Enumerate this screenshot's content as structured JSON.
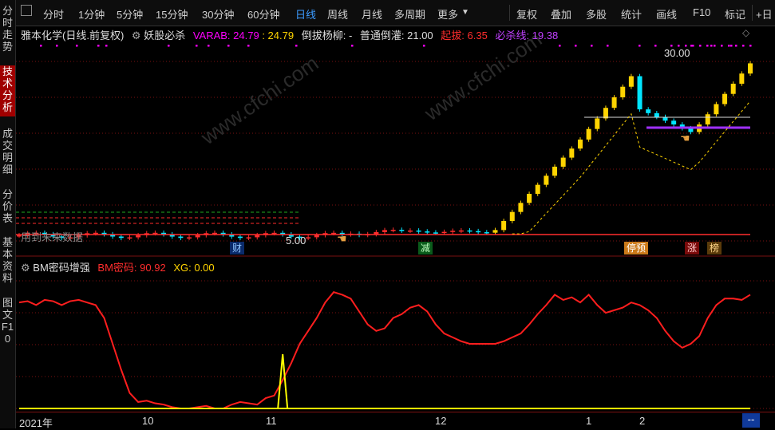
{
  "sidebar": {
    "tabs": [
      "分时走势",
      "技术分析",
      "成交明细",
      "分价表",
      "基本资料",
      "图文F10"
    ],
    "active": "技术分析"
  },
  "toolbar": {
    "periods": [
      "分时",
      "1分钟",
      "5分钟",
      "15分钟",
      "30分钟",
      "60分钟",
      "日线",
      "周线",
      "月线",
      "多周期",
      "更多"
    ],
    "active_period": "日线",
    "tools": [
      "复权",
      "叠加",
      "多股",
      "统计",
      "画线",
      "F10",
      "标记"
    ],
    "plus_day": "+日"
  },
  "main_header": {
    "stock": "雅本化学(日线.前复权)",
    "indicator_name": "妖股必杀",
    "varab_label": "VARAB: 24.79",
    "varab_value": ": 24.79",
    "daoba_label": "倒拔杨柳: -",
    "putong_label": "普通倒灌: 21.00",
    "qiba_label": "起拔: 6.35",
    "bisha_label": "必杀线: 19.38"
  },
  "overlays": {
    "missing_data": "用到未来数据",
    "high_label": "30.00",
    "low_label": "5.00",
    "tags": [
      "财",
      "减",
      "停预",
      "涨",
      "榜"
    ]
  },
  "sub_header": {
    "indicator_name": "BM密码增强",
    "bm_label": "BM密码: 90.92",
    "xg_label": "XG: 0.00"
  },
  "time_axis": {
    "labels": [
      "2021年",
      "10",
      "11",
      "12",
      "1",
      "2"
    ],
    "end_marker": "--"
  },
  "watermark": "www.cfchi.com",
  "colors": {
    "up": "#ff2d2d",
    "down": "#00e5ff",
    "yellow": "#ffd400",
    "magenta": "#ff00ff",
    "purple": "#a030ff",
    "bm_line": "#ff1e1e",
    "xg_line": "#ffff00",
    "grid": "#7a1010"
  },
  "chart_data": [
    {
      "type": "candlestick",
      "title": "雅本化学(日线.前复权)",
      "annotations": {
        "high": 30.0,
        "low": 5.0
      },
      "series": [
        {
          "name": "VARAB",
          "last": 24.79
        },
        {
          "name": "普通倒灌",
          "last": 21.0
        },
        {
          "name": "起拔",
          "last": 6.35
        },
        {
          "name": "必杀线",
          "last": 19.38
        }
      ],
      "ylim": [
        3.5,
        31
      ]
    },
    {
      "type": "line",
      "title": "BM密码增强",
      "series": [
        {
          "name": "BM密码",
          "last": 90.92,
          "values": [
            82,
            83,
            80,
            84,
            83,
            80,
            83,
            84,
            82,
            80,
            70,
            50,
            30,
            12,
            5,
            6,
            4,
            3,
            1,
            0,
            0,
            1,
            2,
            0,
            0,
            3,
            5,
            4,
            3,
            8,
            10,
            22,
            35,
            50,
            60,
            70,
            82,
            90,
            88,
            85,
            75,
            65,
            60,
            62,
            70,
            73,
            78,
            80,
            75,
            65,
            58,
            55,
            52,
            50,
            50,
            50,
            50,
            52,
            55,
            58,
            65,
            73,
            80,
            88,
            84,
            86,
            82,
            88,
            80,
            74,
            76,
            78,
            82,
            80,
            76,
            70,
            60,
            52,
            47,
            50,
            56,
            70,
            80,
            85,
            85,
            84,
            88
          ]
        },
        {
          "name": "XG",
          "last": 0.0,
          "values": [
            0,
            0,
            0,
            0,
            0,
            0,
            0,
            0,
            0,
            0,
            0,
            0,
            0,
            0,
            0,
            0,
            0,
            0,
            0,
            0,
            0,
            0,
            0,
            0,
            0,
            0,
            0,
            0,
            0,
            0,
            0,
            0,
            0,
            0,
            0,
            0,
            0,
            0,
            0,
            0,
            0,
            0,
            0,
            0,
            0,
            0,
            0,
            0,
            0,
            0,
            0,
            0,
            0,
            0,
            0,
            0,
            0,
            0,
            0,
            0,
            0,
            0,
            0,
            0,
            0,
            0,
            0,
            0,
            0,
            0,
            0,
            0,
            0,
            0,
            0,
            0,
            0,
            0,
            0,
            0,
            0,
            0,
            0,
            0,
            0,
            0,
            0
          ]
        }
      ],
      "ylim": [
        0,
        100
      ]
    }
  ]
}
